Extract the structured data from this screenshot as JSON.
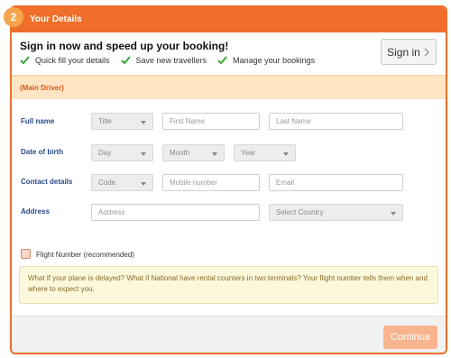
{
  "header": {
    "step_number": "2",
    "title": "Your Details"
  },
  "signin": {
    "heading": "Sign in now and speed up your booking!",
    "perks": [
      "Quick fill your details",
      "Save new travellers",
      "Manage your bookings"
    ],
    "button_label": "Sign in"
  },
  "driver": {
    "label": "(Main Driver)"
  },
  "form": {
    "full_name": {
      "label": "Full name",
      "title_select": "Title",
      "first_name_placeholder": "First Name",
      "last_name_placeholder": "Last Name"
    },
    "date_of_birth": {
      "label": "Date of birth",
      "day_select": "Day",
      "month_select": "Month",
      "year_select": "Year"
    },
    "contact": {
      "label": "Contact details",
      "code_select": "Code",
      "mobile_placeholder": "Mobile number",
      "email_placeholder": "Email"
    },
    "address": {
      "label": "Address",
      "address_placeholder": "Address",
      "country_select": "Select Country"
    }
  },
  "flight": {
    "checkbox_label": "Flight Number (recommended)",
    "checked": false,
    "info_text": "What if your plane is delayed? What if National have rental counters in two terminals? Your flight number tells them when and where to expect you."
  },
  "footer": {
    "continue_label": "Continue"
  },
  "colors": {
    "brand_orange": "#ee6e2a",
    "label_blue": "#2a4a8a",
    "check_green": "#3aa63a",
    "band_peach": "#fde4c3",
    "info_yellow": "#fcf8dc",
    "continue_disabled": "#f7b48e"
  },
  "icons": {
    "perk_icon": "check-icon",
    "signin_icon": "chevron-right-icon",
    "select_icon": "caret-down-icon"
  }
}
